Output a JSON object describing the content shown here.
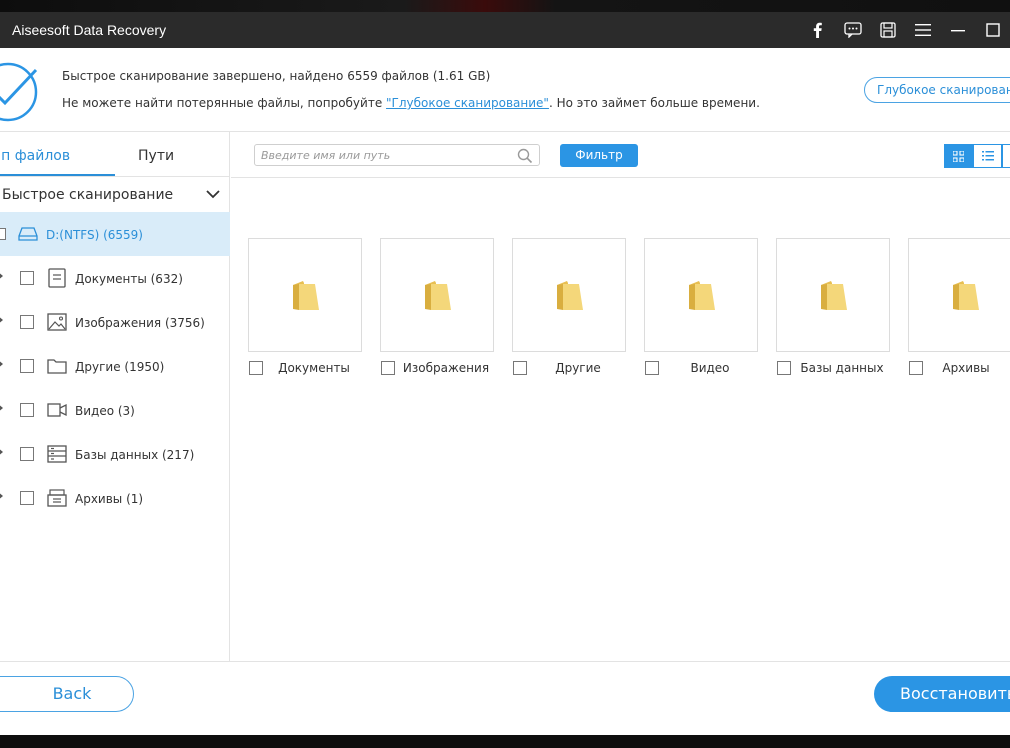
{
  "window": {
    "title": "Aiseesoft Data Recovery",
    "icons": [
      "facebook-icon",
      "feedback-icon",
      "save-icon",
      "menu-icon",
      "minimize-icon",
      "maximize-icon"
    ]
  },
  "status": {
    "line1": "Быстрое сканирование завершено, найдено 6559 файлов (1.61 GB)",
    "line2_prefix": "Не можете найти потерянные файлы, попробуйте ",
    "line2_link": "\"Глубокое сканирование\"",
    "line2_suffix": ". Но это займет больше времени.",
    "deep_scan_button": "Глубокое сканирование"
  },
  "sidebar": {
    "tabs": [
      {
        "label": "ип файлов",
        "active": true
      },
      {
        "label": "Пути",
        "active": false
      }
    ],
    "scan_header": "Быстрое сканирование",
    "drive": {
      "label": "D:(NTFS) (6559)"
    },
    "items": [
      {
        "label": "Документы (632)",
        "icon": "document-icon"
      },
      {
        "label": "Изображения (3756)",
        "icon": "image-icon"
      },
      {
        "label": "Другие (1950)",
        "icon": "folder-icon"
      },
      {
        "label": "Видео (3)",
        "icon": "video-icon"
      },
      {
        "label": "Базы данных (217)",
        "icon": "database-icon"
      },
      {
        "label": "Архивы (1)",
        "icon": "archive-icon"
      }
    ]
  },
  "toolbar": {
    "search_placeholder": "Введите имя или путь",
    "filter_label": "Фильтр"
  },
  "tiles": [
    {
      "label": "Документы"
    },
    {
      "label": "Изображения"
    },
    {
      "label": "Другие"
    },
    {
      "label": "Видео"
    },
    {
      "label": "Базы данных"
    },
    {
      "label": "Архивы"
    }
  ],
  "footer": {
    "back_label": "Back",
    "restore_label": "Восстановить"
  },
  "colors": {
    "accent": "#2b95e4",
    "titlebar": "#2b2b2b",
    "selected_row": "#d9ecf9",
    "folder": "#f2cf6a"
  }
}
